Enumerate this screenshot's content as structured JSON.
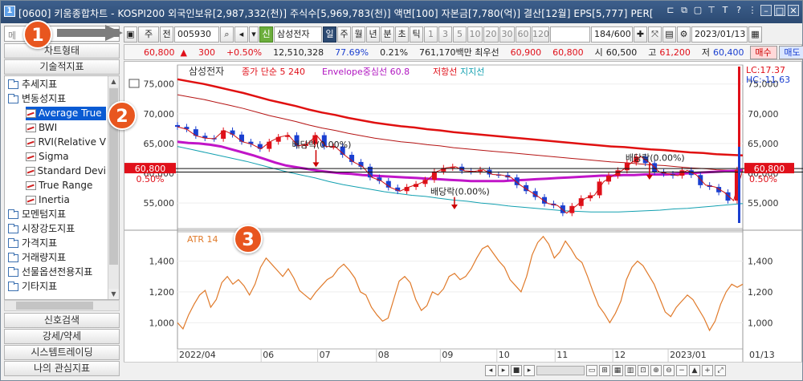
{
  "window": {
    "icon_label": "1",
    "title": "[0600] 키움종합차트 - KOSPI200 외국인보유[2,987,332(천)] 주식수[5,969,783(천)] 액면[100] 자본금[7,780(억)] 결산[12월] EPS[5,777] PER["
  },
  "sidebar": {
    "search_placeholder": "메",
    "tab_chart_type": "차트형태",
    "tab_tech": "기술적지표",
    "tree": [
      {
        "label": "추세지표",
        "kind": "folder"
      },
      {
        "label": "변동성지표",
        "kind": "folder"
      },
      {
        "label": "Average True",
        "kind": "item",
        "selected": true
      },
      {
        "label": "BWI",
        "kind": "item"
      },
      {
        "label": "RVI(Relative V",
        "kind": "item"
      },
      {
        "label": "Sigma",
        "kind": "item"
      },
      {
        "label": "Standard Devi",
        "kind": "item"
      },
      {
        "label": "True Range",
        "kind": "item"
      },
      {
        "label": "Inertia",
        "kind": "item"
      },
      {
        "label": "모멘텀지표",
        "kind": "folder"
      },
      {
        "label": "시장강도지표",
        "kind": "folder"
      },
      {
        "label": "가격지표",
        "kind": "folder"
      },
      {
        "label": "거래량지표",
        "kind": "folder"
      },
      {
        "label": "선물옵션전용지표",
        "kind": "folder"
      },
      {
        "label": "기타지표",
        "kind": "folder"
      }
    ],
    "bottom_buttons": [
      "신호검색",
      "강세/약세",
      "시스템트레이딩",
      "나의 관심지표"
    ]
  },
  "toolbar": {
    "period": "주",
    "prev": "전",
    "code": "005930",
    "stock_tag": "신",
    "stock_name": "삼성전자",
    "periods": [
      "일",
      "주",
      "월",
      "년",
      "분",
      "초",
      "틱"
    ],
    "active_period": "일",
    "numbers": [
      "1",
      "3",
      "5",
      "10",
      "20",
      "30",
      "60",
      "120"
    ],
    "count": "184/600",
    "date": "2023/01/13"
  },
  "quote": {
    "price": "60,800",
    "change": "300",
    "change_pct": "+0.50%",
    "volume": "12,510,328",
    "ratio": "77.69%",
    "turnover": "0.21%",
    "amount": "761,170백만 최우선",
    "best_ask": "60,900",
    "best_bid": "60,800",
    "open_label": "시",
    "open": "60,500",
    "high_label": "고",
    "high": "61,200",
    "low_label": "저",
    "low": "60,400",
    "buy": "매수",
    "sell": "매도"
  },
  "legend": {
    "stock": "삼성전자",
    "close": "종가 단순 5",
    "close_val": "240",
    "envelope": "Envelope중심선 60.8",
    "resist": "저항선",
    "support": "지지선",
    "atr": "ATR 14"
  },
  "right_info": {
    "lc": "LC:17.37",
    "hc": "HC:-11.63",
    "price_tag": "60,800",
    "pct_tag": "0.50%"
  },
  "annotations": {
    "div1": "배당락(0.00%)",
    "div2": "배당락(0.00%)",
    "div3": "배당락(0.00%)"
  },
  "callouts": [
    "1",
    "2",
    "3"
  ],
  "chart_data": [
    {
      "type": "line",
      "title": "",
      "y_ticks": [
        "75,000",
        "70,000",
        "65,000",
        "60,000",
        "55,000"
      ],
      "y_range": [
        50700,
        78200
      ],
      "x_labels": [
        "2022/04",
        "06",
        "07",
        "08",
        "09",
        "10",
        "11",
        "12",
        "2023/01"
      ],
      "series": [
        {
          "name": "종가 단순 5",
          "values": [
            67800,
            67400,
            66300,
            65900,
            65800,
            67200,
            66500,
            65300,
            64900,
            64100,
            65300,
            66100,
            66400,
            64600,
            64900,
            66400,
            64500,
            64500,
            63100,
            61900,
            61100,
            59300,
            58700,
            57600,
            57000,
            57700,
            58200,
            58900,
            60300,
            60900,
            61100,
            60400,
            60300,
            60600,
            59800,
            59700,
            59300,
            58000,
            57000,
            56000,
            54900,
            54600,
            53300,
            54500,
            55800,
            56300,
            58600,
            59600,
            60500,
            61800,
            62800,
            61700,
            60200,
            59900,
            59600,
            60500,
            59700,
            58000,
            57700,
            56800,
            55400,
            60600
          ]
        },
        {
          "name": "Envelope중심선 60.8",
          "values": [
            65300,
            65100,
            65000,
            64800,
            64500,
            64000,
            63500,
            63000,
            62400,
            61800,
            61300,
            61000,
            60700,
            60400,
            60200,
            60000,
            59900,
            59700,
            59600,
            59500,
            59400,
            59300,
            59200,
            59100,
            59000,
            58900,
            58800,
            58700,
            58700,
            58700,
            58700,
            58800,
            58900,
            59000,
            59100,
            59200,
            59300,
            59400,
            59500,
            59600,
            59600,
            59700,
            59700,
            59800,
            59800,
            59800,
            59900,
            60000,
            60100,
            60200,
            60300,
            60400,
            60500
          ]
        },
        {
          "name": "저항선",
          "values": [
            75800,
            75400,
            75000,
            74500,
            74000,
            73500,
            72900,
            72300,
            71800,
            71300,
            70700,
            70200,
            69800,
            69300,
            68900,
            68500,
            68200,
            67900,
            67700,
            67400,
            67200,
            66900,
            66700,
            66500,
            66300,
            66100,
            65900,
            65700,
            65500,
            65300,
            65100,
            64900,
            64700,
            64500,
            64400,
            64200,
            64000,
            63900,
            63700,
            63500,
            63400,
            63200,
            63100,
            63000
          ]
        },
        {
          "name": "지지선",
          "values": [
            64500,
            64000,
            63500,
            63000,
            62500,
            62000,
            61400,
            60800,
            60200,
            59700,
            59200,
            58600,
            58100,
            57700,
            57300,
            56900,
            56600,
            56300,
            56100,
            55800,
            55500,
            55300,
            55000,
            54800,
            54500,
            54300,
            54100,
            53900,
            53700,
            53600,
            53500,
            53500,
            53500,
            53600,
            53700,
            53800,
            54000,
            54100,
            54300,
            54500,
            54700,
            54900
          ]
        }
      ]
    },
    {
      "type": "line",
      "title": "ATR 14",
      "y_ticks": [
        "1,400",
        "1,200",
        "1,000"
      ],
      "y_range": [
        830,
        1590
      ],
      "series": [
        {
          "name": "ATR 14",
          "values": [
            1000,
            960,
            1050,
            1120,
            1180,
            1210,
            1100,
            1150,
            1260,
            1300,
            1250,
            1280,
            1240,
            1180,
            1250,
            1360,
            1420,
            1380,
            1340,
            1300,
            1350,
            1290,
            1210,
            1180,
            1150,
            1200,
            1240,
            1280,
            1300,
            1350,
            1380,
            1340,
            1290,
            1200,
            1180,
            1100,
            1050,
            1010,
            1030,
            1150,
            1270,
            1300,
            1260,
            1150,
            1080,
            1110,
            1200,
            1180,
            1220,
            1300,
            1320,
            1280,
            1300,
            1350,
            1420,
            1480,
            1500,
            1450,
            1400,
            1360,
            1280,
            1240,
            1200,
            1300,
            1440,
            1520,
            1560,
            1510,
            1420,
            1460,
            1530,
            1480,
            1420,
            1390,
            1300,
            1200,
            1110,
            1060,
            1000,
            1060,
            1140,
            1280,
            1360,
            1400,
            1370,
            1310,
            1250,
            1160,
            1070,
            1040,
            1100,
            1140,
            1180,
            1150,
            1090,
            1030,
            950,
            1010,
            1120,
            1200,
            1250,
            1230,
            1250
          ]
        }
      ]
    }
  ]
}
